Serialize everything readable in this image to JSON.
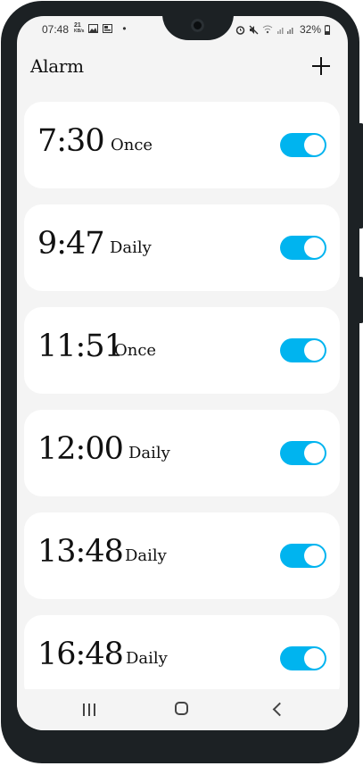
{
  "status_bar": {
    "time": "07:48",
    "net_speed_top": "21",
    "net_speed_bottom": "KB/s",
    "dot": "•",
    "battery": "32%"
  },
  "header": {
    "title": "Alarm",
    "add_icon": "plus-icon"
  },
  "alarms": [
    {
      "time": "7:30",
      "repeat": "Once",
      "enabled": true
    },
    {
      "time": "9:47",
      "repeat": "Daily",
      "enabled": true
    },
    {
      "time": "11:51",
      "repeat": "Once",
      "enabled": true
    },
    {
      "time": "12:00",
      "repeat": "Daily",
      "enabled": true
    },
    {
      "time": "13:48",
      "repeat": "Daily",
      "enabled": true
    },
    {
      "time": "16:48",
      "repeat": "Daily",
      "enabled": true
    }
  ],
  "colors": {
    "toggle_on": "#00b4ef",
    "screen_bg": "#f4f4f4",
    "card_bg": "#ffffff",
    "frame": "#1c2124"
  },
  "nav_bar": {
    "recents_icon": "recents-icon",
    "home_icon": "home-icon",
    "back_icon": "back-icon"
  }
}
